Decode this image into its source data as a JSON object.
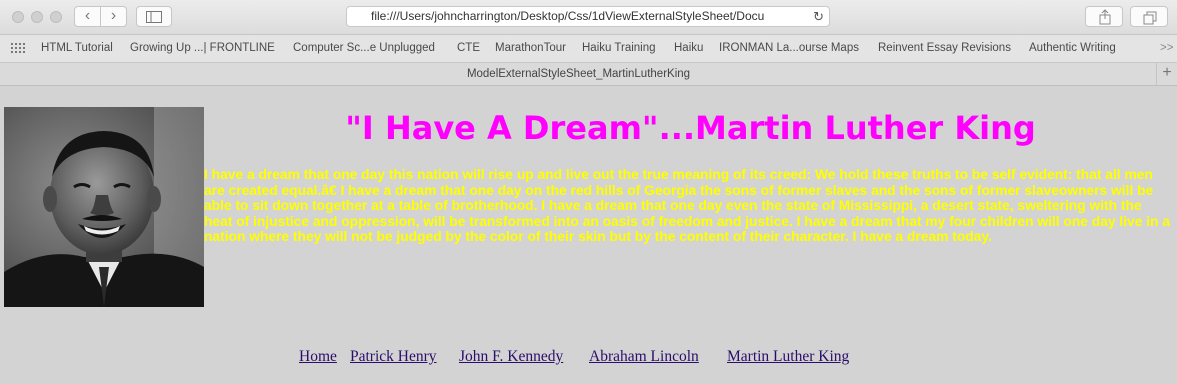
{
  "browser": {
    "url": "file:///Users/johncharrington/Desktop/Css/1dViewExternalStyleSheet/Docu",
    "bookmarks": [
      "HTML Tutorial",
      "Growing Up ...| FRONTLINE",
      "Computer Sc...e Unplugged",
      "CTE",
      "MarathonTour",
      "Haiku Training",
      "Haiku",
      "IRONMAN La...ourse Maps",
      "Reinvent Essay Revisions",
      "Authentic Writing"
    ],
    "overflow": ">>",
    "tab_title": "ModelExternalStyleSheet_MartinLutherKing",
    "new_tab_glyph": "+"
  },
  "page": {
    "heading": "\"I Have A Dream\"...Martin Luther King",
    "speech": "I have a dream that one day this nation will rise up and live out the true meaning of its creed: We hold these truths to be self evident: that all men are created equal.â€ I have a dream that one day on the red hills of Georgia the sons of former slaves and the sons of former slaveowners will be able to sit down together at a table of brotherhood. I have a dream that one day even the state of Mississippi, a desert state, sweltering with the heat of injustice and oppression, will be transformed into an oasis of freedom and justice. I have a dream that my four children will one day live in a nation where they will not be judged by the color of their skin but by the content of their character. I have a dream today.",
    "nav_links": [
      "Home",
      "Patrick Henry",
      "John F. Kennedy",
      "Abraham Lincoln",
      "Martin Luther King"
    ]
  },
  "colors": {
    "page_background": "#d3d3d3",
    "heading": "#ff00ff",
    "speech_text": "#ffff00",
    "link": "#2b0d6b"
  }
}
